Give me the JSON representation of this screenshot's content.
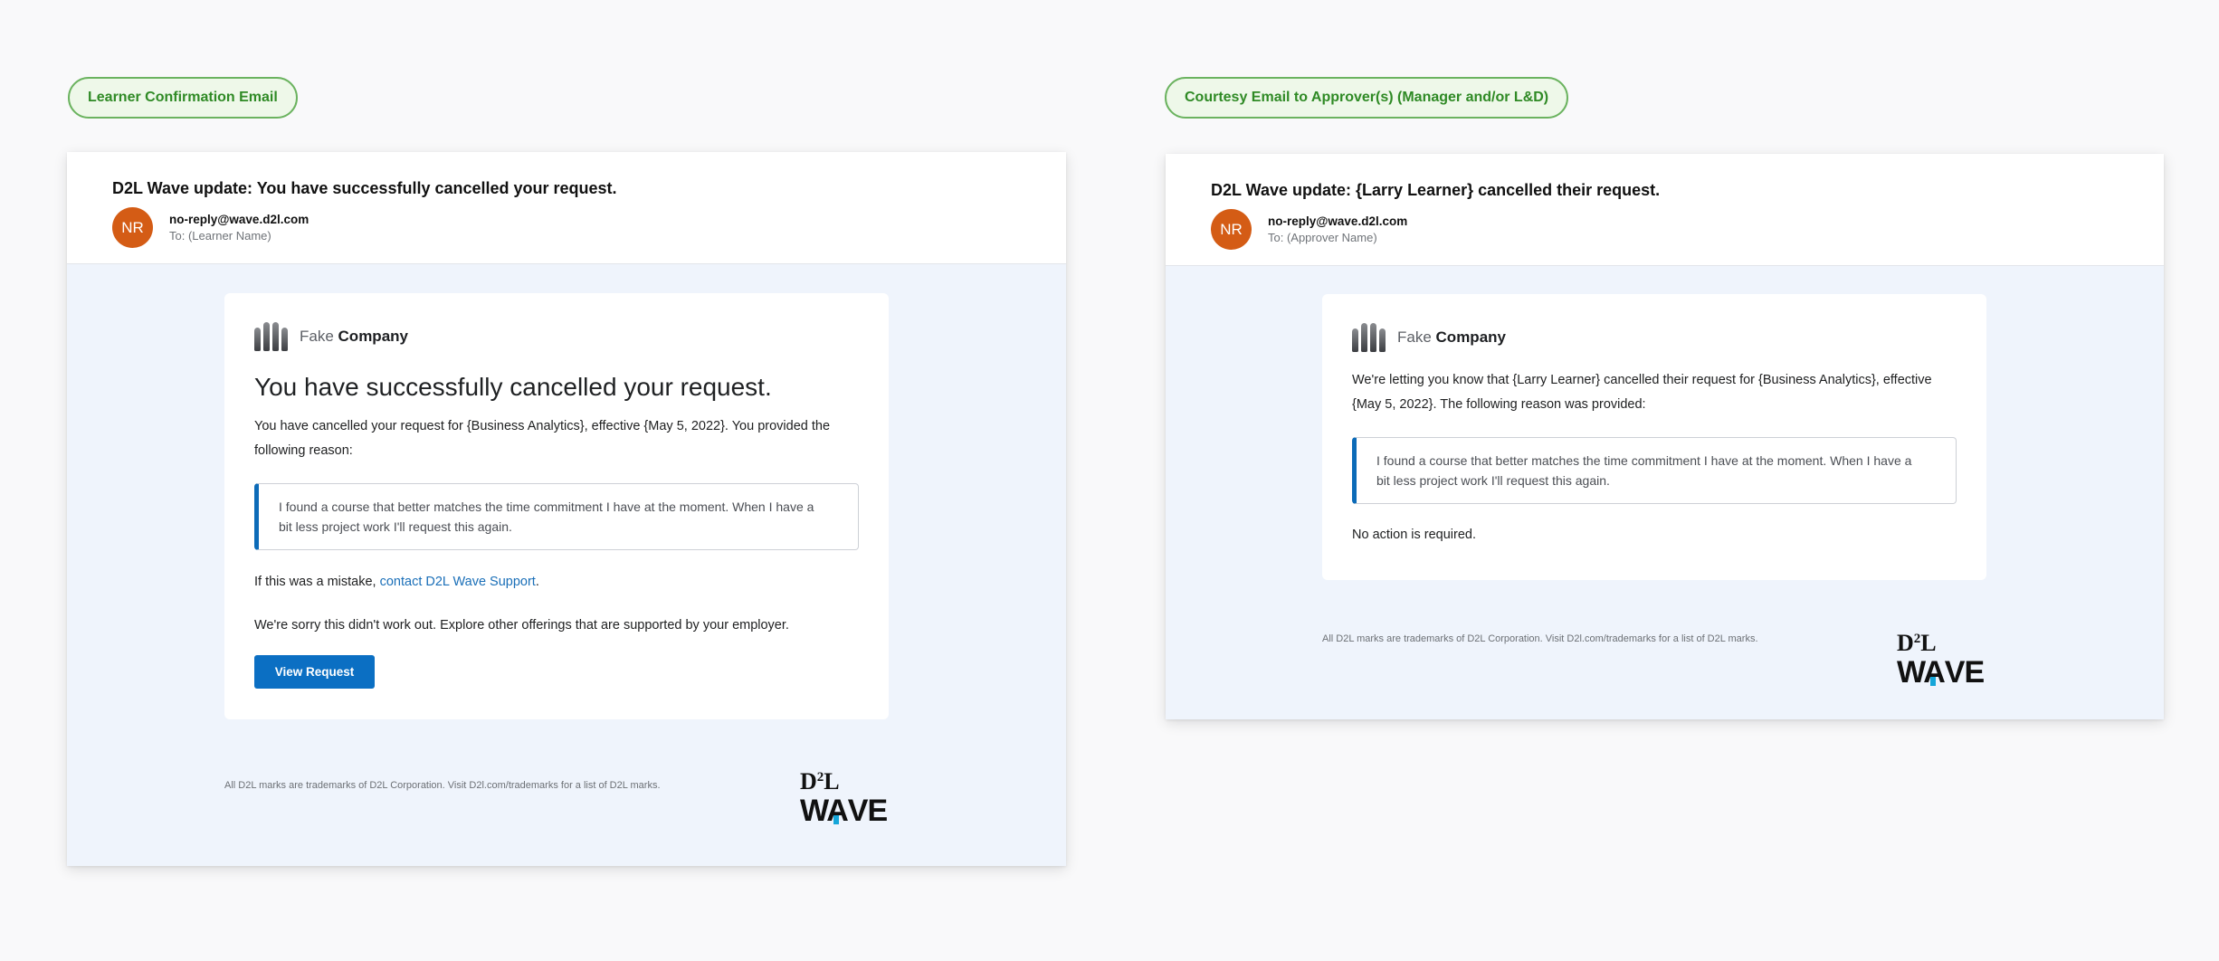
{
  "left": {
    "pill_label": "Learner Confirmation Email",
    "subject": "D2L Wave update: You have successfully cancelled your request.",
    "avatar_initials": "NR",
    "sender": "no-reply@wave.d2l.com",
    "to": "To: (Learner Name)",
    "company_prefix": "Fake",
    "company_name": "Company",
    "title": "You have successfully cancelled your request.",
    "body_line1": "You have cancelled your request for {Business Analytics}, effective {May 5, 2022}. You provided the",
    "body_line2": "following reason:",
    "quote_line1": "I found a course that better matches the time commitment I have at the moment. When I have a",
    "quote_line2": "bit less project work I'll request this again.",
    "mistake_prefix": "If this was a mistake, ",
    "mistake_link": "contact D2L Wave Support",
    "mistake_suffix": ".",
    "sorry_text": "We're sorry this didn't work out. Explore other offerings that are supported by your employer.",
    "button_label": "View Request",
    "footer_note": "All D2L marks are trademarks of D2L Corporation. Visit D2l.com/trademarks for a list of D2L marks."
  },
  "right": {
    "pill_label": "Courtesy Email to Approver(s) (Manager and/or L&D)",
    "subject": "D2L Wave update: {Larry Learner} cancelled their request.",
    "avatar_initials": "NR",
    "sender": "no-reply@wave.d2l.com",
    "to": "To: (Approver Name)",
    "company_prefix": "Fake",
    "company_name": "Company",
    "body_line1": "We're letting you know that {Larry Learner} cancelled their request for {Business Analytics}, effective",
    "body_line2": "{May 5, 2022}. The following reason was provided:",
    "quote_line1": "I found a course that better matches the time commitment I have at the moment. When I have a",
    "quote_line2": "bit less project work I'll request this again.",
    "no_action": "No action is required.",
    "footer_note": "All D2L marks are trademarks of D2L Corporation. Visit D2l.com/trademarks for a list of D2L marks."
  },
  "brand": {
    "d2l_1": "D",
    "d2l_2": "2",
    "d2l_3": "L",
    "wave_1": "W",
    "wave_2": "A",
    "wave_3": "VE",
    "accent": "#15a6d9",
    "button_color": "#0b6fc3",
    "avatar_color": "#d45c15"
  }
}
